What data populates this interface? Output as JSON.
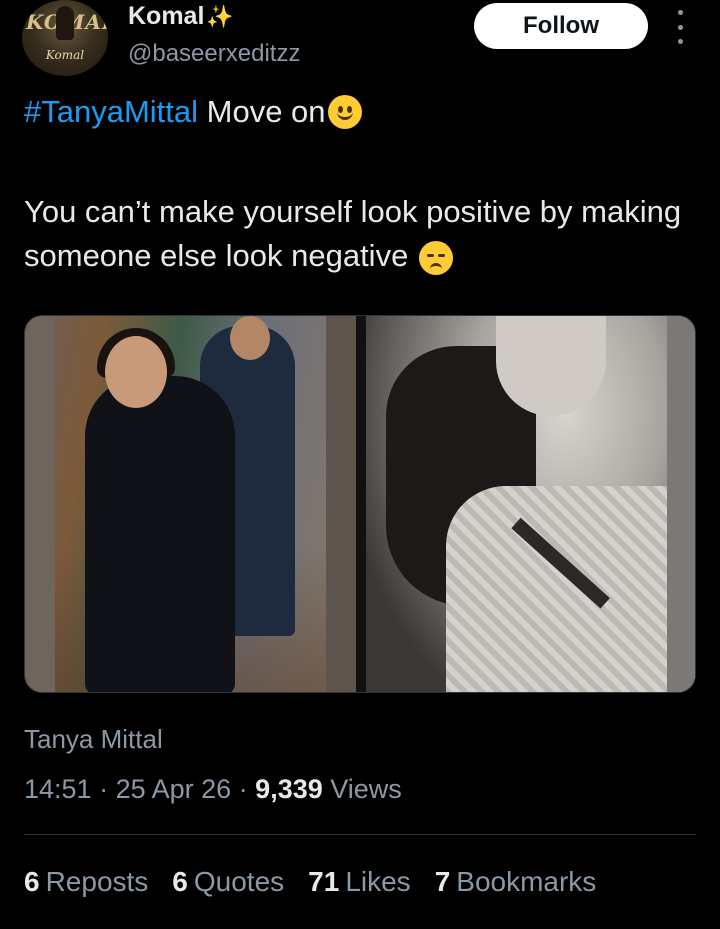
{
  "author": {
    "name": "Komal",
    "name_emoji": "✨",
    "handle": "@baseerxeditzz",
    "avatar": {
      "text_top": "KOMAL",
      "text_bottom": "Komal"
    }
  },
  "follow_label": "Follow",
  "tweet": {
    "hashtag": "#TanyaMittal",
    "line1_text": " Move on",
    "line1_emoji": "slightly-smiling-face",
    "body": "You can’t make yourself look positive by making someone else look negative",
    "body_emoji": "pensive-face"
  },
  "media_caption": "Tanya Mittal",
  "meta": {
    "time": "14:51",
    "sep1": " · ",
    "date": "25 Apr 26",
    "sep2": " · ",
    "views_count": "9,339",
    "views_label": " Views"
  },
  "stats": {
    "reposts": {
      "count": "6",
      "label": "Reposts"
    },
    "quotes": {
      "count": "6",
      "label": "Quotes"
    },
    "likes": {
      "count": "71",
      "label": "Likes"
    },
    "bookmarks": {
      "count": "7",
      "label": "Bookmarks"
    }
  },
  "colors": {
    "background": "#000000",
    "text": "#e7e9ea",
    "secondary": "#8b98a5",
    "hashtag": "#1d9bf0"
  }
}
